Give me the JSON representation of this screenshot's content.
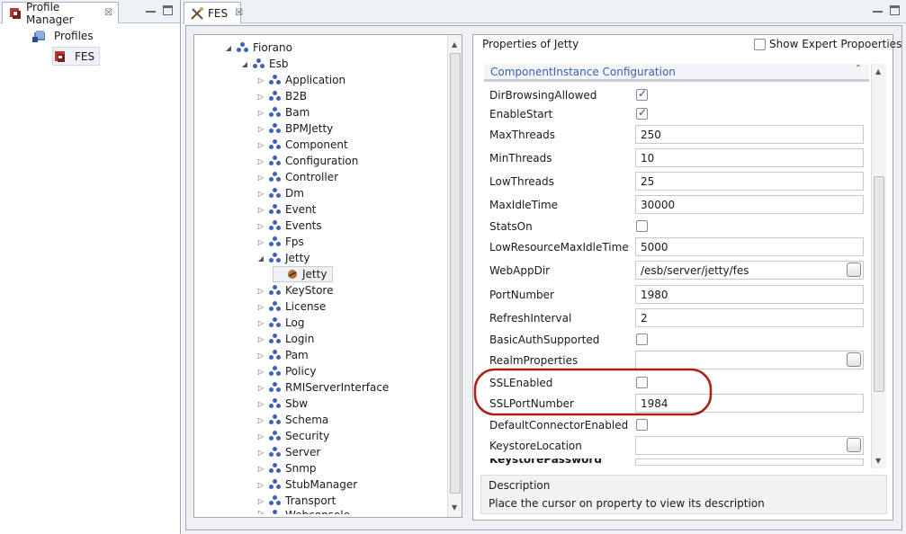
{
  "profile_manager": {
    "tab_label": "Profile Manager",
    "close_glyph": "☒",
    "root_label": "Profiles",
    "child_label": "FES"
  },
  "editor": {
    "tab_label": "FES",
    "close_glyph": "☒"
  },
  "tree": {
    "root": "Fiorano",
    "esb": "Esb",
    "nodes": [
      "Application",
      "B2B",
      "Bam",
      "BPMJetty",
      "Component",
      "Configuration",
      "Controller",
      "Dm",
      "Event",
      "Events",
      "Fps",
      "Jetty"
    ],
    "jetty_child": "Jetty",
    "nodes_after": [
      "KeyStore",
      "License",
      "Log",
      "Login",
      "Pam",
      "Policy",
      "RMIServerInterface",
      "Sbw",
      "Schema",
      "Security",
      "Server",
      "Snmp",
      "StubManager",
      "Transport"
    ],
    "partial_last": "Webconsole"
  },
  "properties": {
    "title": "Properties of Jetty",
    "expert_label": "Show Expert Propoerties",
    "section_title": "ComponentInstance Configuration",
    "rows": [
      {
        "name": "DirBrowsingAllowed",
        "type": "check",
        "checked": true
      },
      {
        "name": "EnableStart",
        "type": "check",
        "checked": true
      },
      {
        "name": "MaxThreads",
        "type": "text",
        "value": "250"
      },
      {
        "name": "MinThreads",
        "type": "text",
        "value": "10"
      },
      {
        "name": "LowThreads",
        "type": "text",
        "value": "25"
      },
      {
        "name": "MaxIdleTime",
        "type": "text",
        "value": "30000"
      },
      {
        "name": "StatsOn",
        "type": "check",
        "checked": false
      },
      {
        "name": "LowResourceMaxIdleTime",
        "type": "text",
        "value": "5000"
      },
      {
        "name": "WebAppDir",
        "type": "file",
        "value": "/esb/server/jetty/fes"
      },
      {
        "name": "PortNumber",
        "type": "text",
        "value": "1980"
      },
      {
        "name": "RefreshInterval",
        "type": "text",
        "value": "2"
      },
      {
        "name": "BasicAuthSupported",
        "type": "check",
        "checked": false
      },
      {
        "name": "RealmProperties",
        "type": "file",
        "value": ""
      },
      {
        "name": "SSLEnabled",
        "type": "check",
        "checked": false
      },
      {
        "name": "SSLPortNumber",
        "type": "text",
        "value": "1984"
      },
      {
        "name": "DefaultConnectorEnabled",
        "type": "check",
        "checked": false
      },
      {
        "name": "KeystoreLocation",
        "type": "file",
        "value": ""
      },
      {
        "name": "KeystorePassword",
        "type": "text",
        "value": ""
      }
    ],
    "description_title": "Description",
    "description_text": "Place the cursor on property to view its description"
  },
  "colors": {
    "highlight_ring": "#a8201a",
    "section_text": "#3a5fb0",
    "tree_icon": "#3b63b5"
  }
}
